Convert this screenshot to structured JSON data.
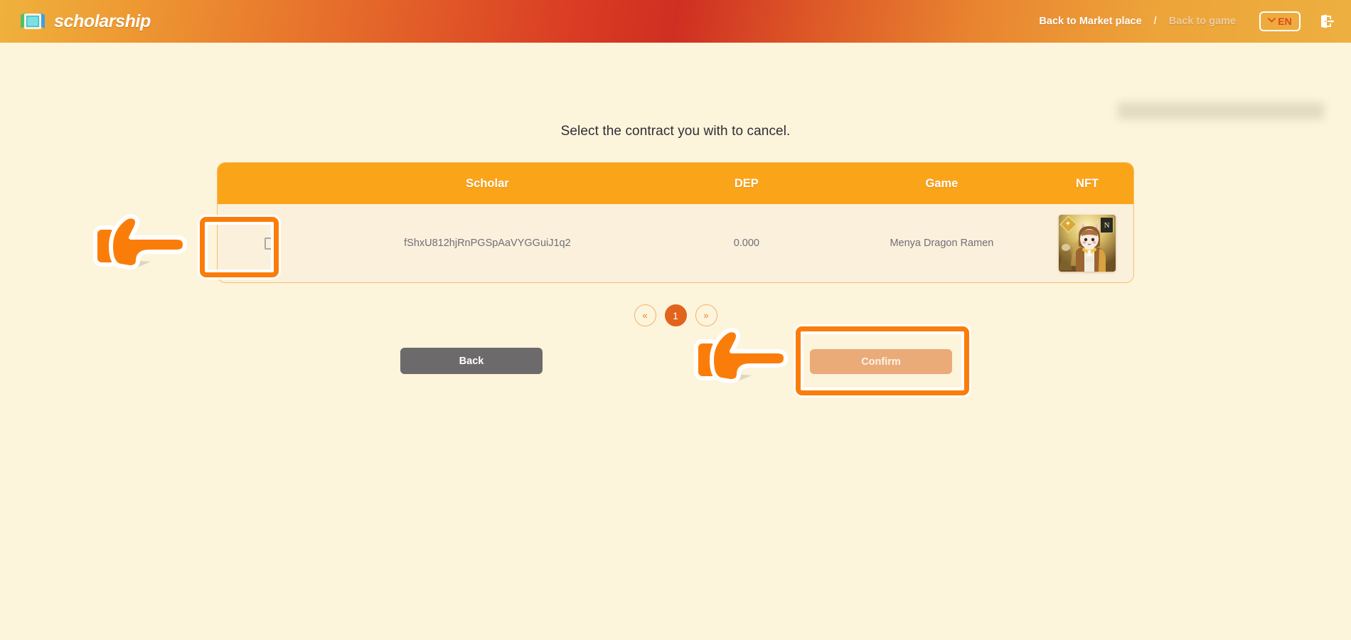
{
  "header": {
    "brand": "scholarship",
    "brand_logo_icon": "scholarship-book-logo-icon",
    "nav": {
      "marketplace_label": "Back to Market place",
      "separator": "/",
      "game_label": "Back to game"
    },
    "language": {
      "chevron_icon": "chevron-down-icon",
      "label": "EN"
    },
    "logout_icon": "logout-icon",
    "gradient_from": "#efb23c",
    "gradient_mid": "#cf2f22",
    "gradient_to": "#edb040"
  },
  "main": {
    "title": "Select the contract you with to cancel.",
    "redacted_placeholder": ""
  },
  "table": {
    "columns": [
      "",
      "Scholar",
      "DEP",
      "Game",
      "NFT"
    ],
    "header_bg": "#faa41a",
    "row_bg": "#fbf0dc",
    "rows": [
      {
        "selected": false,
        "checkbox_icon": "checkbox-unchecked-icon",
        "scholar": "fShxU812hjRnPGSpAaVYGGuiJ1q2",
        "dep": "0.000",
        "game": "Menya Dragon Ramen",
        "nft": {
          "alt": "bunny-hood-character-nft",
          "rank_badge": "N",
          "star_badge": "✦"
        }
      }
    ]
  },
  "pagination": {
    "prev_label": "«",
    "next_label": "»",
    "pages": [
      "1"
    ],
    "current": "1",
    "active_color": "#e2631c"
  },
  "actions": {
    "back_label": "Back",
    "confirm_label": "Confirm",
    "back_color": "#6c6a6a",
    "confirm_color": "#eaab79"
  },
  "annotations": {
    "pointer_icon": "pointing-hand-icon",
    "highlight_color": "#fb7d09",
    "targets": [
      "row-checkbox",
      "confirm-button"
    ]
  }
}
